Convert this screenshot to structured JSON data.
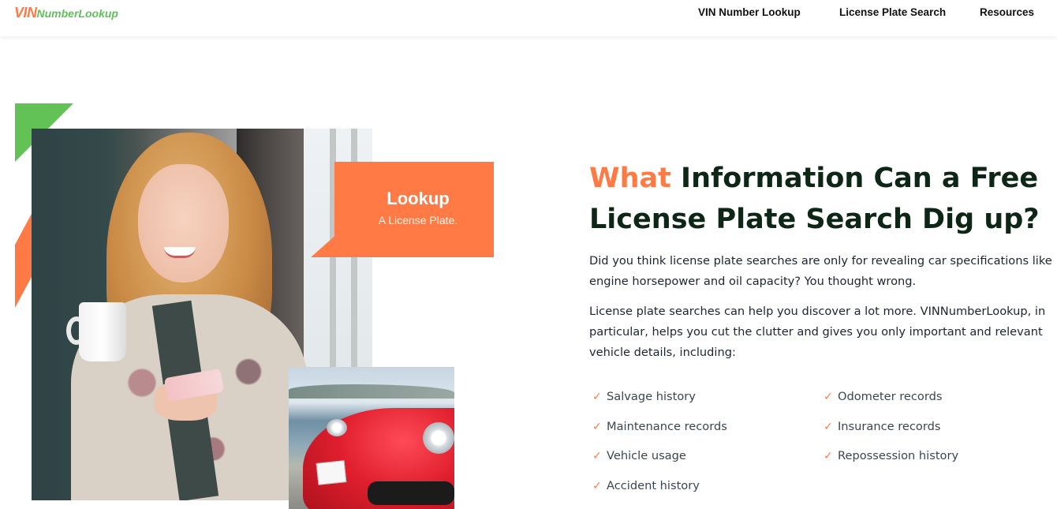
{
  "header": {
    "logo_vin": "VIN",
    "logo_rest": "NumberLookup",
    "nav": [
      "VIN Number Lookup",
      "License Plate Search",
      "Resources"
    ]
  },
  "banner": {
    "title": "Lookup",
    "subtitle": "A License Plate."
  },
  "main": {
    "heading_accent": "What",
    "heading_rest": " Information Can a Free License Plate Search Dig up?",
    "paragraph_1": "Did you think license plate searches are only for revealing car specifications like engine horsepower and oil capacity? You thought wrong.",
    "paragraph_2": "License plate searches can help you discover a lot more. VINNumberLookup, in particular, helps you cut the clutter and gives you only important and relevant vehicle details, including:",
    "list_left": [
      "Salvage history",
      "Maintenance records",
      "Vehicle usage",
      "Accident history"
    ],
    "list_right": [
      "Odometer records",
      "Insurance records",
      "Repossession history"
    ]
  },
  "icons": {
    "check": "check-icon"
  },
  "colors": {
    "accent_orange": "#ff7a45",
    "accent_green": "#62c256",
    "heading": "#0d2616"
  }
}
